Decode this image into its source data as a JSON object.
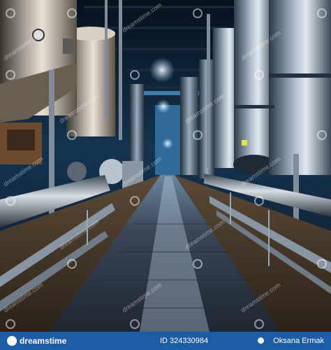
{
  "scene": {
    "subject": "industrial brewery interior with steel tanks and pipes",
    "palette": {
      "shadow": "#0a1724",
      "steel": "#8fa4b8",
      "copper": "#b07a4a",
      "highlight": "#e8f3ff",
      "floor": "#3b4757"
    }
  },
  "watermark": {
    "text": "dreamstime.com"
  },
  "footer": {
    "brand": "dreamstime",
    "image_id": "ID 324330984",
    "author": "Oksana Ermak"
  }
}
